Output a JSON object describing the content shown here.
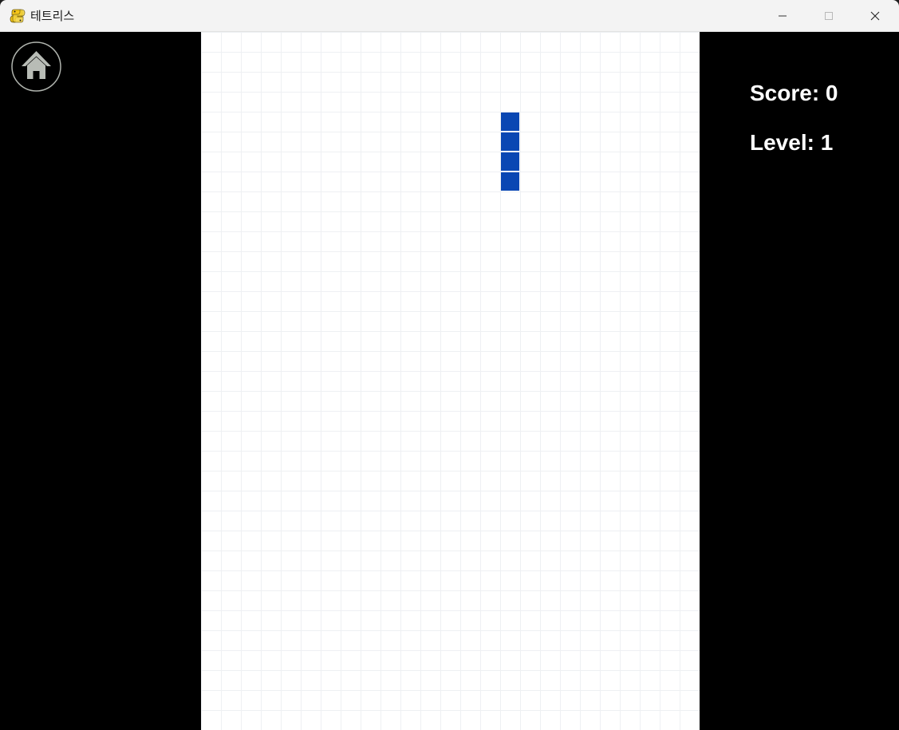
{
  "window": {
    "title": "테트리스",
    "icon": "python-snake-icon"
  },
  "window_controls": {
    "minimize_icon": "minimize-icon",
    "maximize_icon": "maximize-icon",
    "close_icon": "close-icon"
  },
  "home_button": {
    "icon": "home-icon"
  },
  "stats": {
    "score_text": "Score: 0",
    "level_text": "Level: 1"
  },
  "board": {
    "columns": 25,
    "rows": 35,
    "grid_color": "#eef0f3",
    "background": "#ffffff",
    "current_piece": {
      "shape": "I",
      "orientation": "vertical",
      "color": "#0a47b3",
      "cells": [
        {
          "col": 15,
          "row": 4
        },
        {
          "col": 15,
          "row": 5
        },
        {
          "col": 15,
          "row": 6
        },
        {
          "col": 15,
          "row": 7
        }
      ]
    }
  }
}
